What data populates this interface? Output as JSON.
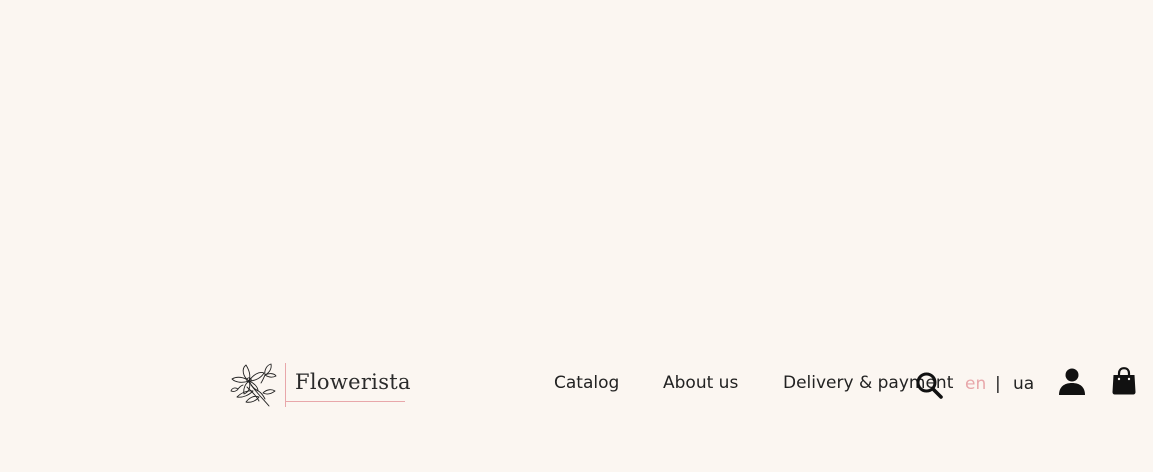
{
  "header": {
    "logo": {
      "text": "Flowerista",
      "icon": "flower-icon"
    },
    "nav": [
      {
        "label": "Catalog"
      },
      {
        "label": "About us"
      },
      {
        "label": "Delivery & payment"
      }
    ],
    "search": {
      "icon": "search-icon"
    },
    "language": {
      "options": [
        "en",
        "ua"
      ],
      "separator": "|",
      "active": "en"
    },
    "account": {
      "icon": "user-icon"
    },
    "cart": {
      "icon": "shopping-bag-icon"
    }
  },
  "colors": {
    "background": "#fbf6f1",
    "accent": "#e8a7aa",
    "text": "#222222"
  }
}
